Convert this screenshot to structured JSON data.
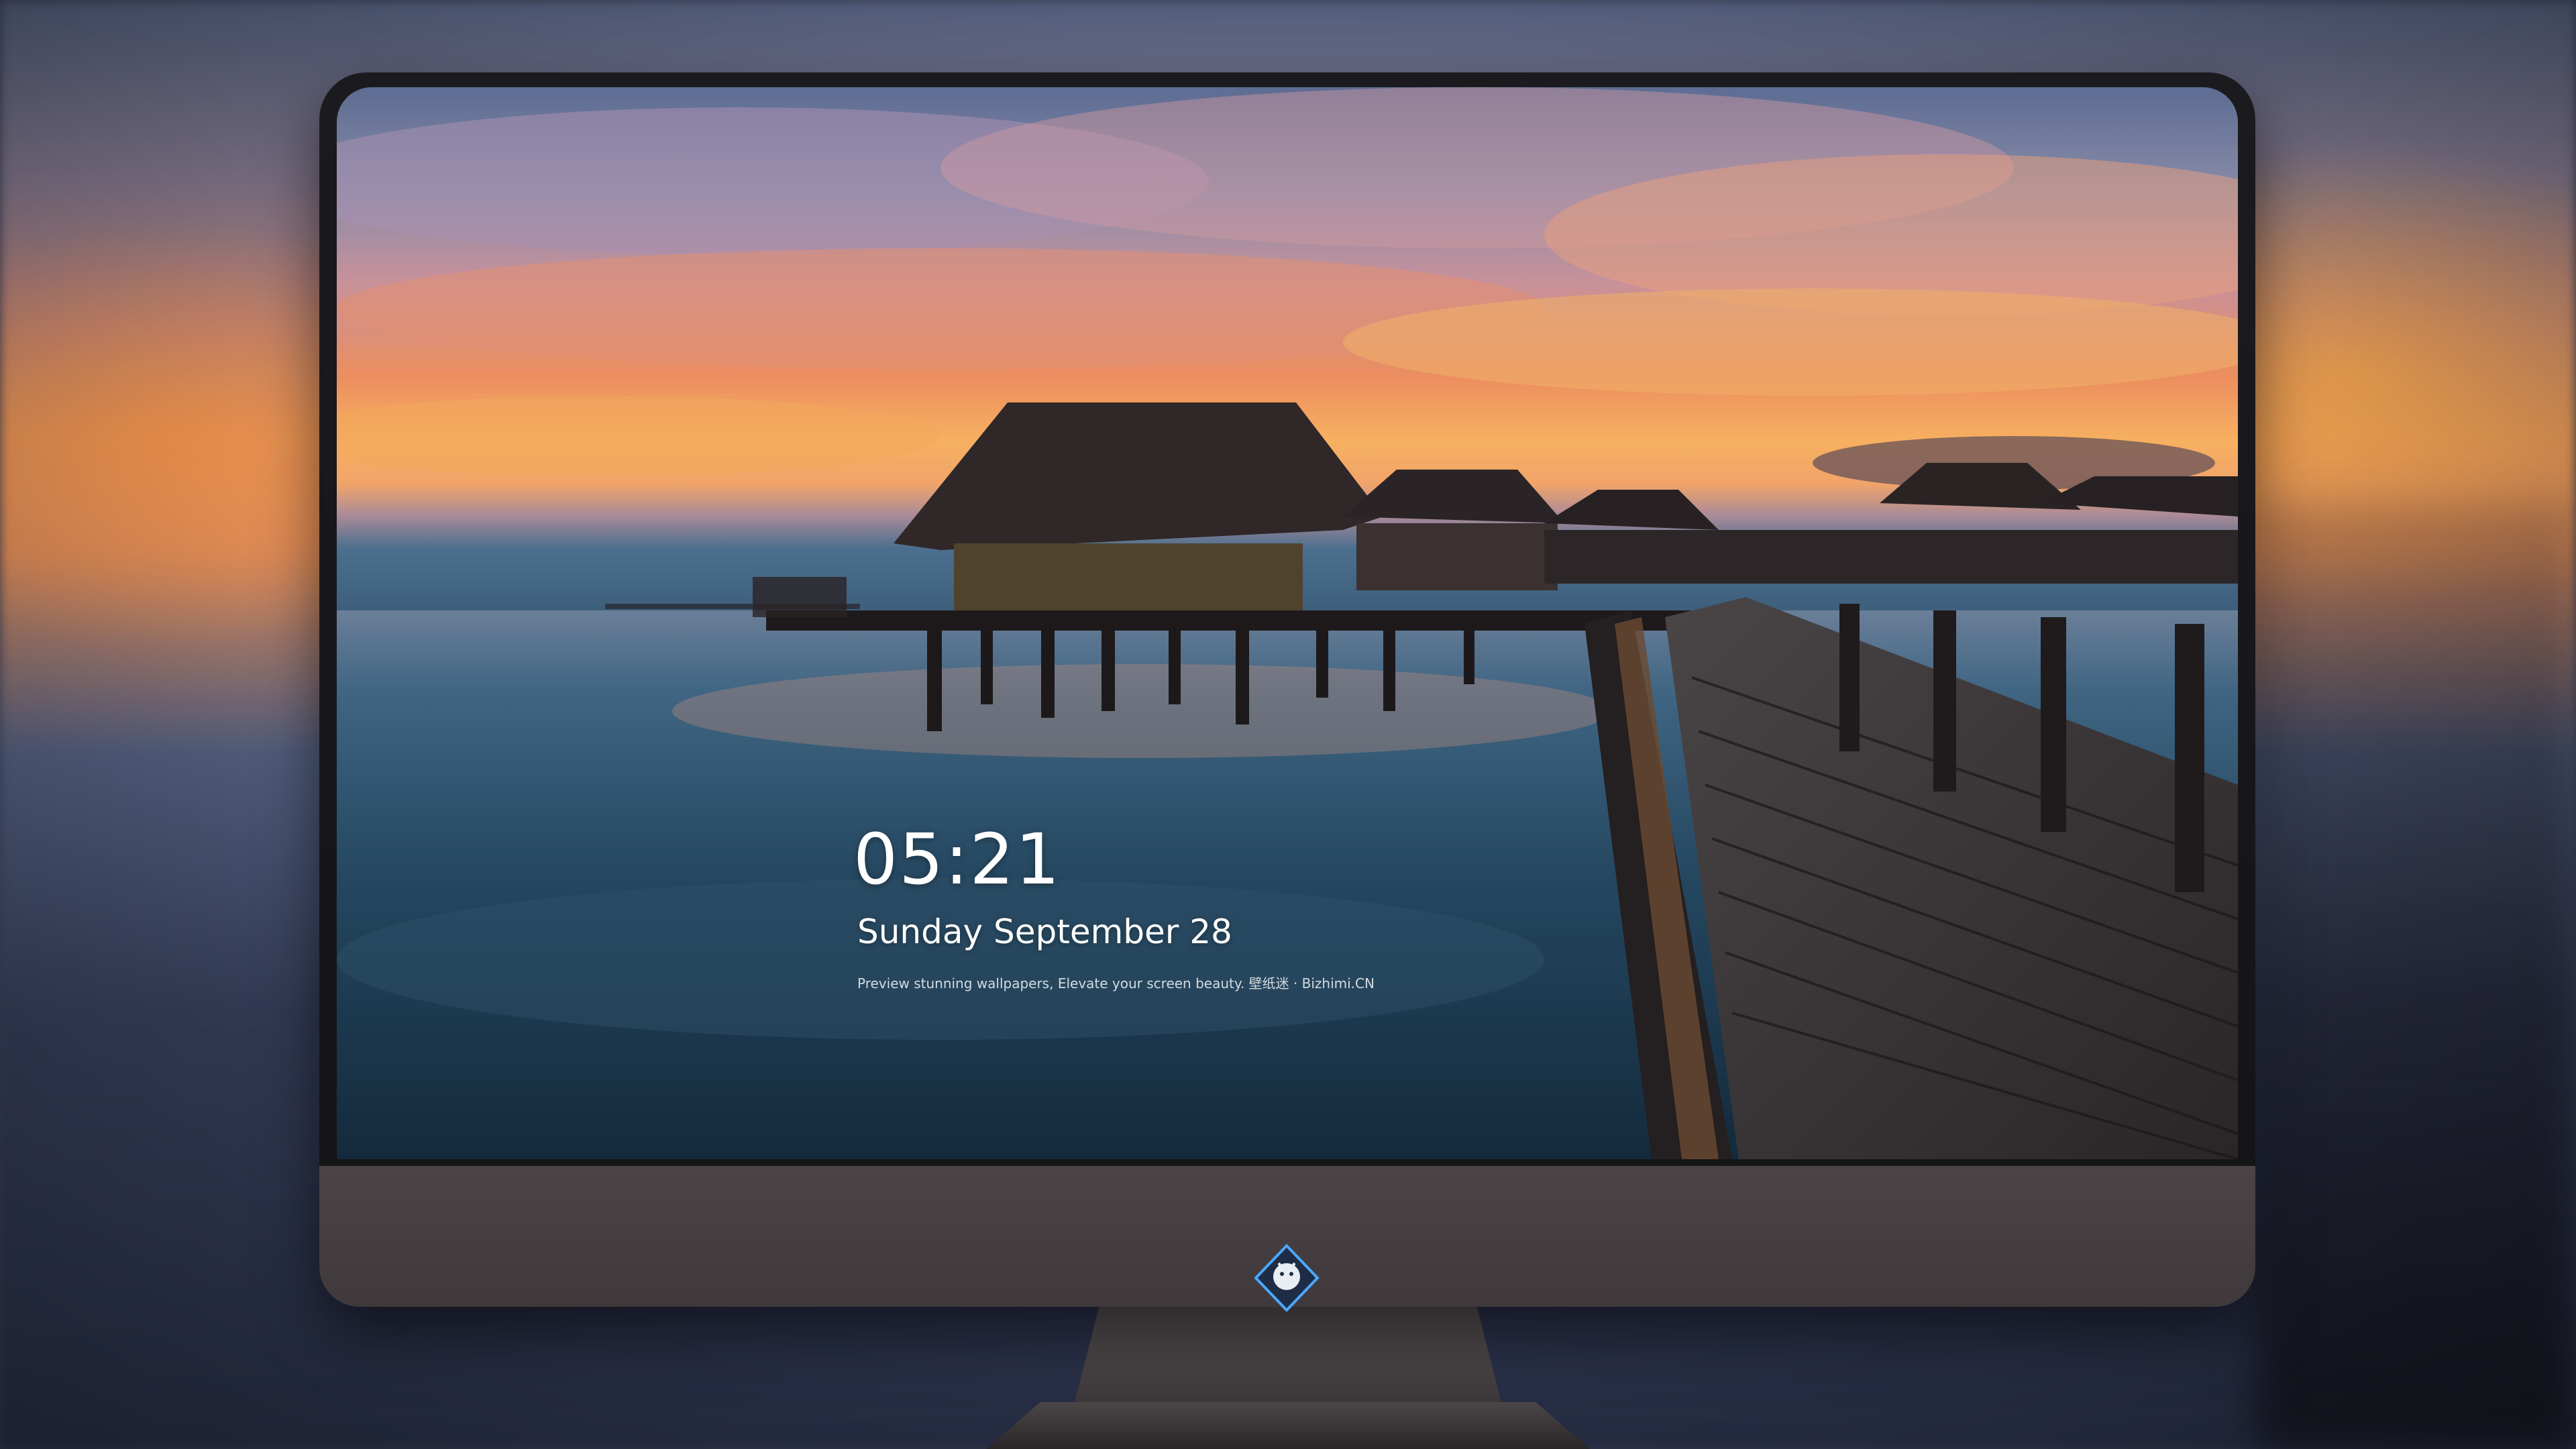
{
  "lock_screen": {
    "time": "05:21",
    "date": "Sunday September  28",
    "tagline": "Preview stunning wallpapers, Elevate your screen beauty. 壁纸迷 · Bizhimi.CN"
  },
  "dock": {
    "apps": [
      {
        "name": "messages-icon",
        "color": "#34c759"
      },
      {
        "name": "weather-icon",
        "color": "#2f8cf0"
      },
      {
        "name": "clock-icon",
        "color": "#1c1c1e"
      },
      {
        "name": "preview-icon",
        "color": "#e9c23a"
      },
      {
        "name": "clips-icon",
        "color": "#3cc3e8"
      },
      {
        "name": "notes-icon",
        "color": "#ffd54a"
      },
      {
        "name": "photo-collage-icon",
        "color": "#f6f6f6"
      },
      {
        "name": "music-icon",
        "color": "#e25cf0"
      },
      {
        "name": "app-store-icon",
        "color": "#1e8cf2"
      },
      {
        "name": "camera-icon",
        "color": "#8e8e93"
      }
    ]
  },
  "monitor": {
    "badge": "dragon-logo-icon"
  }
}
